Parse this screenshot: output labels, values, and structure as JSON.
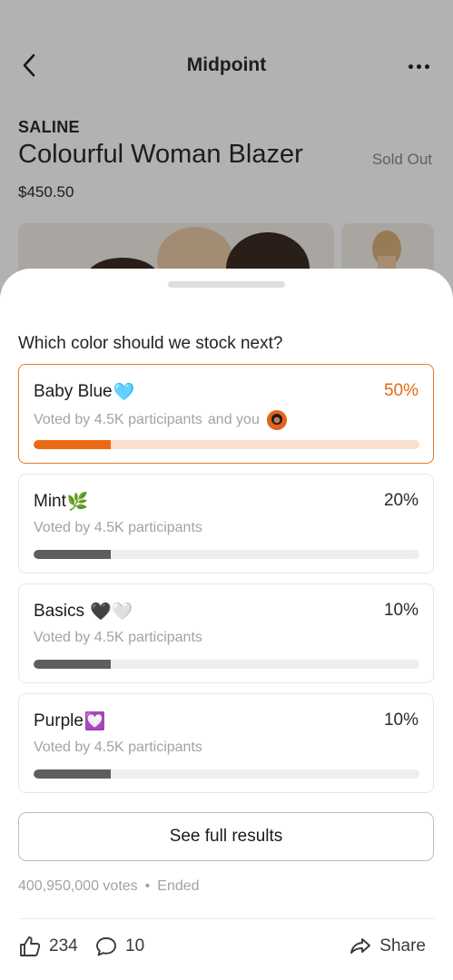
{
  "header": {
    "title": "Midpoint"
  },
  "product": {
    "brand": "SALINE",
    "name": "Colourful Woman Blazer",
    "status": "Sold Out",
    "price": "$450.50"
  },
  "poll": {
    "question": "Which color should we stock next?",
    "options": [
      {
        "label": "Baby Blue",
        "emoji": "🩵",
        "percent_label": "50%",
        "percent": 50,
        "voted_by": "Voted by 4.5K participants",
        "you_suffix": "and you",
        "selected": true,
        "bar_fill_fraction": 0.2
      },
      {
        "label": "Mint",
        "emoji": "🌿",
        "percent_label": "20%",
        "percent": 20,
        "voted_by": "Voted by 4.5K participants",
        "selected": false,
        "bar_fill_fraction": 0.2
      },
      {
        "label": "Basics",
        "emoji": "🖤🤍",
        "percent_label": "10%",
        "percent": 10,
        "voted_by": "Voted by 4.5K participants",
        "selected": false,
        "bar_fill_fraction": 0.2
      },
      {
        "label": "Purple",
        "emoji": "💟",
        "percent_label": "10%",
        "percent": 10,
        "voted_by": "Voted by 4.5K participants",
        "selected": false,
        "bar_fill_fraction": 0.2
      }
    ],
    "results_button": "See full results",
    "votes": "400,950,000 votes",
    "separator": "•",
    "state": "Ended"
  },
  "actions": {
    "likes": "234",
    "comments": "10",
    "share": "Share"
  },
  "colors": {
    "accent": "#EC6A12",
    "accent_track": "#FBE0CD",
    "neutral_fill": "#5E5E5E"
  },
  "icons": [
    "back-chevron-icon",
    "more-dots-icon",
    "thumbs-up-icon",
    "comment-bubble-icon",
    "share-arrow-icon"
  ]
}
